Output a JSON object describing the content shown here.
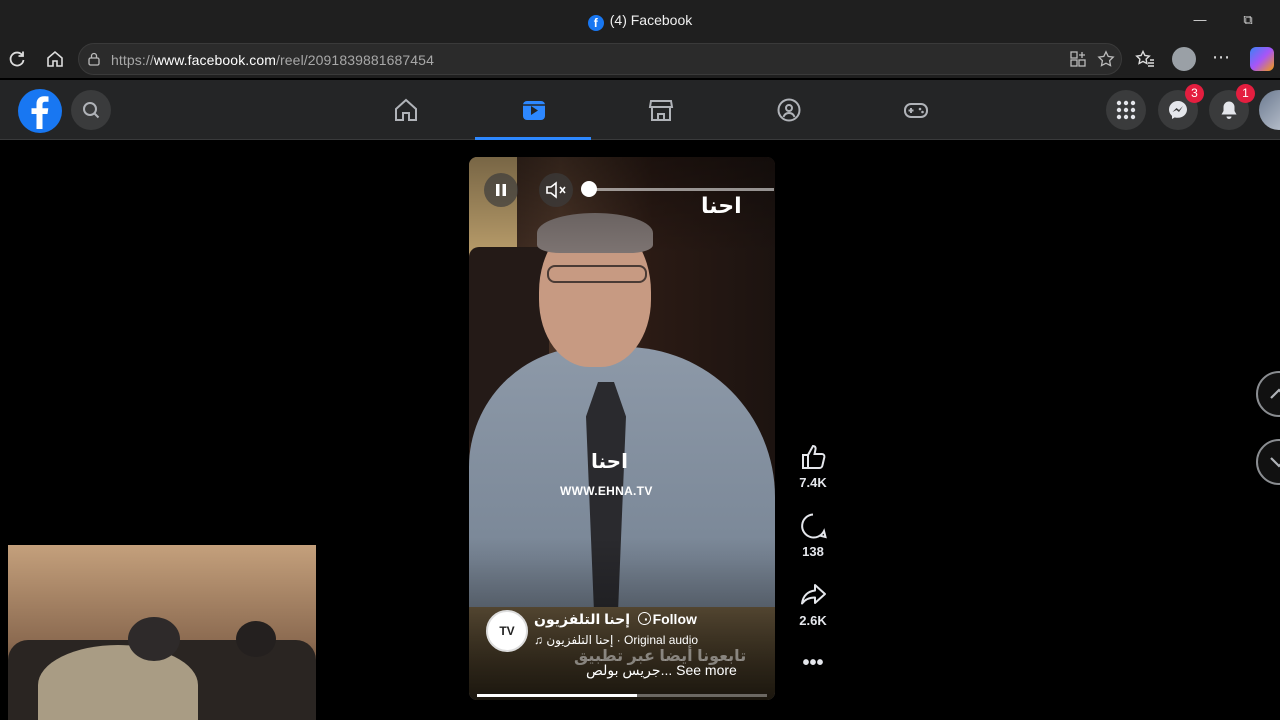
{
  "browser": {
    "tab_title": "(4) Facebook",
    "url_prefix": "https://",
    "url_host": "www.facebook.com",
    "url_path": "/reel/2091839881687454"
  },
  "header": {
    "messenger_badge": "3",
    "notifications_badge": "1",
    "active_tab": "reels"
  },
  "reel": {
    "watermark": "احنا",
    "watermark_url": "WWW.EHNA.TV",
    "author_avatar_text": "TV",
    "author_name": "إحنا التلفزيون",
    "follow_label": "Follow",
    "audio_label": "إحنا التلفزيون · Original audio",
    "overlay_text": "تابعونا أيضا عبر تطبيق",
    "caption": "جريس بولص... See more",
    "progress": 0.55
  },
  "actions": {
    "likes": "7.4K",
    "comments": "138",
    "shares": "2.6K"
  },
  "colors": {
    "fb_blue": "#1877f2",
    "active_tab": "#2d88ff",
    "badge": "#e41e3f"
  }
}
